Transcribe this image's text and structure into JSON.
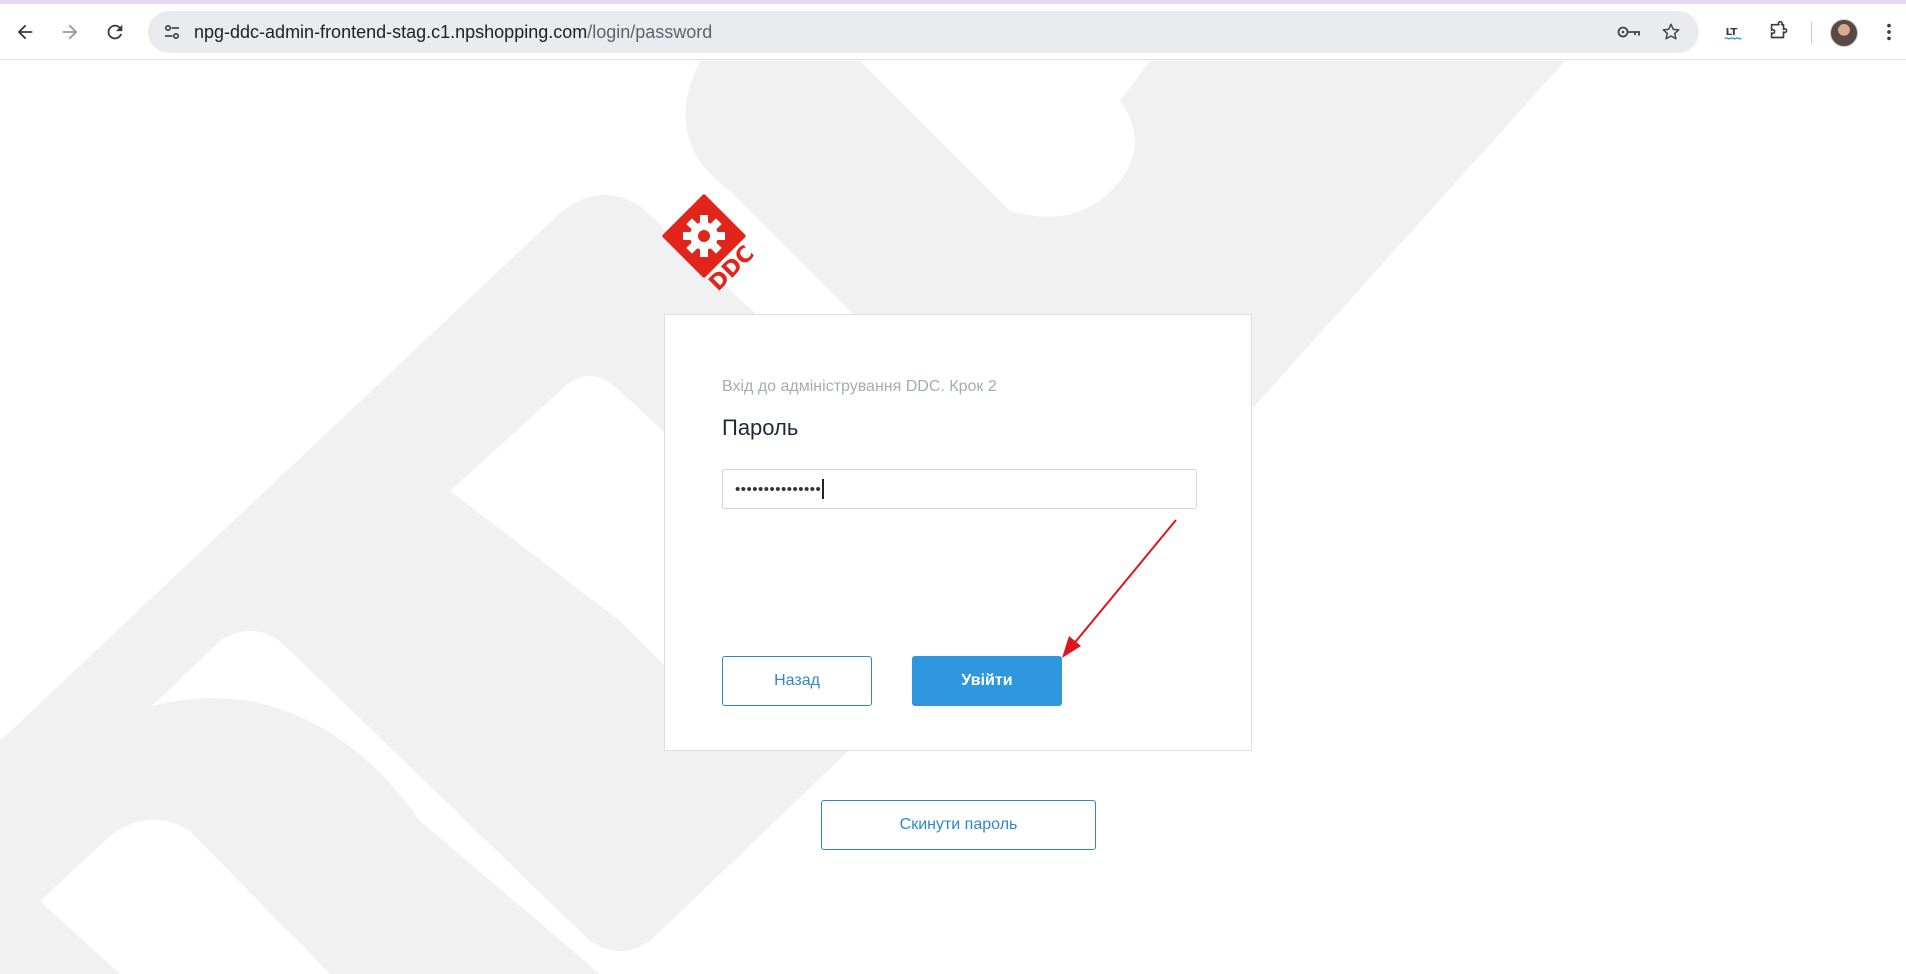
{
  "browser": {
    "url_domain": "npg-ddc-admin-frontend-stag.c1.npshopping.com",
    "url_path": "/login/password",
    "icons": [
      "back-icon",
      "forward-icon",
      "reload-icon",
      "site-info-icon",
      "key-icon",
      "star-icon",
      "lt-extension-icon",
      "extensions-icon",
      "avatar",
      "more-icon"
    ]
  },
  "logo": {
    "text": "DDC",
    "color": "#e1251b"
  },
  "form": {
    "subtitle": "Вхід до адміністрування DDC. Крок 2",
    "password_label": "Пароль",
    "password_value": "•••••••••••••••",
    "back_button": "Назад",
    "login_button": "Увійти",
    "reset_button": "Скинути пароль"
  },
  "colors": {
    "accent": "#2f97e0",
    "annotation_arrow": "#e0141c"
  }
}
